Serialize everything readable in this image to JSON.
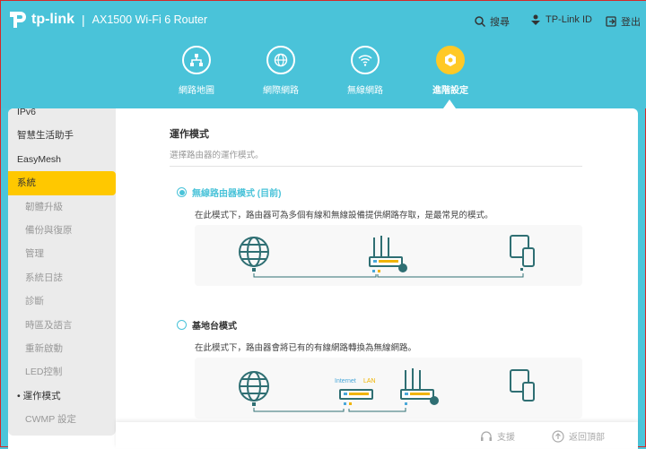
{
  "header": {
    "brand": "tp-link",
    "separator": "|",
    "model": "AX1500 Wi-Fi 6 Router",
    "search": "搜尋",
    "tplink_id": "TP-Link ID",
    "logout": "登出"
  },
  "nav": [
    {
      "label": "網路地圖",
      "icon": "network-map-icon"
    },
    {
      "label": "網際網路",
      "icon": "globe-icon"
    },
    {
      "label": "無線網路",
      "icon": "wifi-icon"
    },
    {
      "label": "進階設定",
      "icon": "gear-icon",
      "active": true
    }
  ],
  "sidebar": {
    "items": [
      {
        "label": "IPv6"
      },
      {
        "label": "智慧生活助手"
      },
      {
        "label": "EasyMesh"
      },
      {
        "label": "系統",
        "active": true
      },
      {
        "label": "韌體升級",
        "sub": true
      },
      {
        "label": "備份與復原",
        "sub": true
      },
      {
        "label": "管理",
        "sub": true
      },
      {
        "label": "系統日誌",
        "sub": true
      },
      {
        "label": "診斷",
        "sub": true
      },
      {
        "label": "時區及語言",
        "sub": true
      },
      {
        "label": "重新啟動",
        "sub": true
      },
      {
        "label": "LED控制",
        "sub": true
      },
      {
        "label": "• 運作模式",
        "sub": true,
        "current": true
      },
      {
        "label": "CWMP 設定",
        "sub": true
      }
    ]
  },
  "main": {
    "title": "運作模式",
    "description": "選擇路由器的運作模式。",
    "options": [
      {
        "label": "無線路由器模式 (目前)",
        "selected": true,
        "text": "在此模式下，路由器可為多個有線和無線設備提供網路存取，是最常見的模式。"
      },
      {
        "label": "基地台模式",
        "selected": false,
        "text": "在此模式下，路由器會將已有的有線網路轉換為無線網路。",
        "internet_label": "Internet",
        "lan_label": "LAN"
      }
    ]
  },
  "footer": {
    "support": "支援",
    "back_to_top": "返回頂部"
  },
  "colors": {
    "header": "#4ac3d9",
    "accent": "#ffc800",
    "icon": "#2f6f73"
  }
}
